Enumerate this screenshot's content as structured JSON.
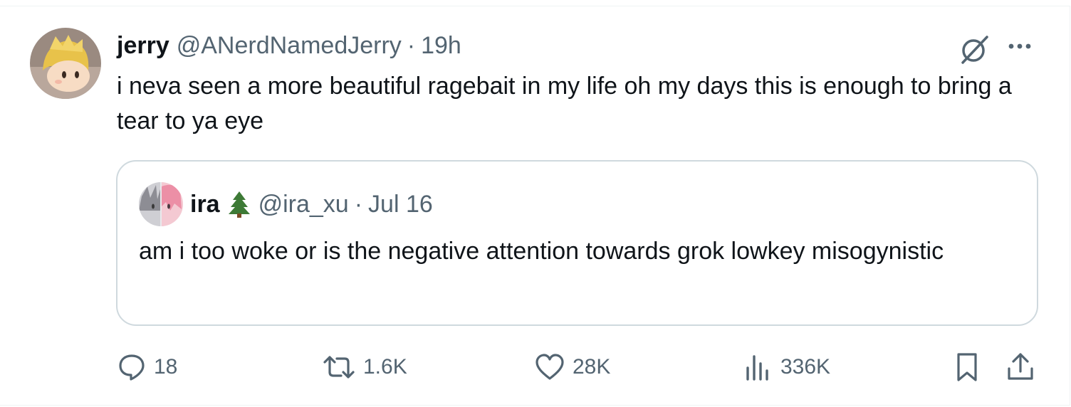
{
  "colors": {
    "text_primary": "#0f1419",
    "text_secondary": "#536471",
    "border": "#cfd9de",
    "divider": "#eff3f4"
  },
  "tweet": {
    "author_name": "jerry",
    "author_handle": "@ANerdNamedJerry",
    "separator": "·",
    "timestamp": "19h",
    "text": "i neva seen a more beautiful ragebait in my life oh my days this is enough to bring a tear to ya eye",
    "avatar_icon": "avatar-icon",
    "grok_icon": "grok-icon",
    "more_icon": "more-icon"
  },
  "quoted_tweet": {
    "author_name": "ira",
    "emoji": "🌲",
    "author_handle": "@ira_xu",
    "separator": "·",
    "date": "Jul 16",
    "text": "am i too woke or is the negative attention towards grok lowkey misogynistic"
  },
  "actions": {
    "reply_count": "18",
    "retweet_count": "1.6K",
    "like_count": "28K",
    "view_count": "336K"
  }
}
